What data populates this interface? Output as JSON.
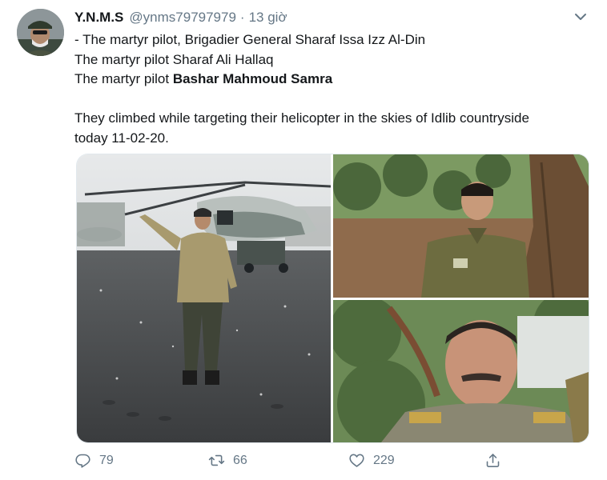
{
  "tweet": {
    "display_name": "Y.N.M.S",
    "handle": "@ynms79797979",
    "separator": "·",
    "time": "13 giờ",
    "text_lines": [
      "- The martyr pilot, Brigadier General Sharaf Issa Izz Al-Din",
      "The martyr pilot Sharaf Ali Hallaq"
    ],
    "third_line_prefix": "The martyr pilot ",
    "third_line_bold": "Bashar Mahmoud Samra",
    "paragraph2_lines": [
      "They climbed while targeting their helicopter in the skies of Idlib countryside",
      "today 11-02-20."
    ]
  },
  "actions": {
    "reply_count": "79",
    "retweet_count": "66",
    "like_count": "229"
  },
  "icons": {
    "more": "chevron-down-icon",
    "reply": "reply-icon",
    "retweet": "retweet-icon",
    "like": "heart-icon",
    "share": "share-icon"
  },
  "colors": {
    "text": "#14171a",
    "secondary": "#657786",
    "border": "#e1e8ed"
  }
}
